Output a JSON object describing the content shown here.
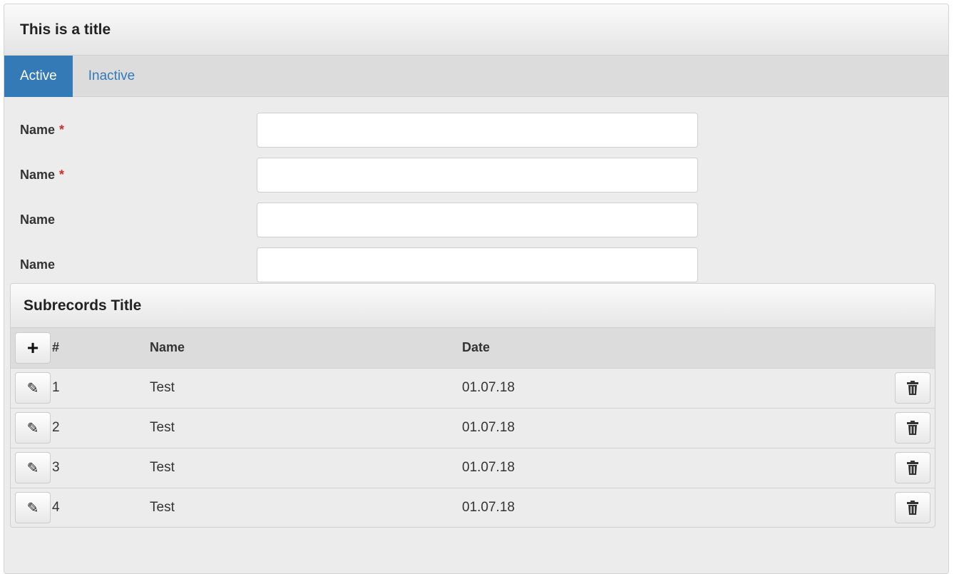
{
  "panel": {
    "title": "This is a title"
  },
  "tabs": [
    {
      "label": "Active"
    },
    {
      "label": "Inactive"
    }
  ],
  "form": {
    "fields": [
      {
        "label": "Name",
        "required_mark": "*",
        "value": ""
      },
      {
        "label": "Name",
        "required_mark": "*",
        "value": ""
      },
      {
        "label": "Name",
        "required_mark": "",
        "value": ""
      },
      {
        "label": "Name",
        "required_mark": "",
        "value": ""
      }
    ]
  },
  "subrecords": {
    "title": "Subrecords Title",
    "columns": {
      "num": "#",
      "name": "Name",
      "date": "Date"
    },
    "rows": [
      {
        "num": "1",
        "name": "Test",
        "date": "01.07.18"
      },
      {
        "num": "2",
        "name": "Test",
        "date": "01.07.18"
      },
      {
        "num": "3",
        "name": "Test",
        "date": "01.07.18"
      },
      {
        "num": "4",
        "name": "Test",
        "date": "01.07.18"
      }
    ]
  },
  "icons": {
    "add": "plus-icon",
    "edit": "pencil-icon",
    "delete": "trash-icon"
  },
  "colors": {
    "accent": "#337ab7",
    "required": "#c9302c"
  }
}
